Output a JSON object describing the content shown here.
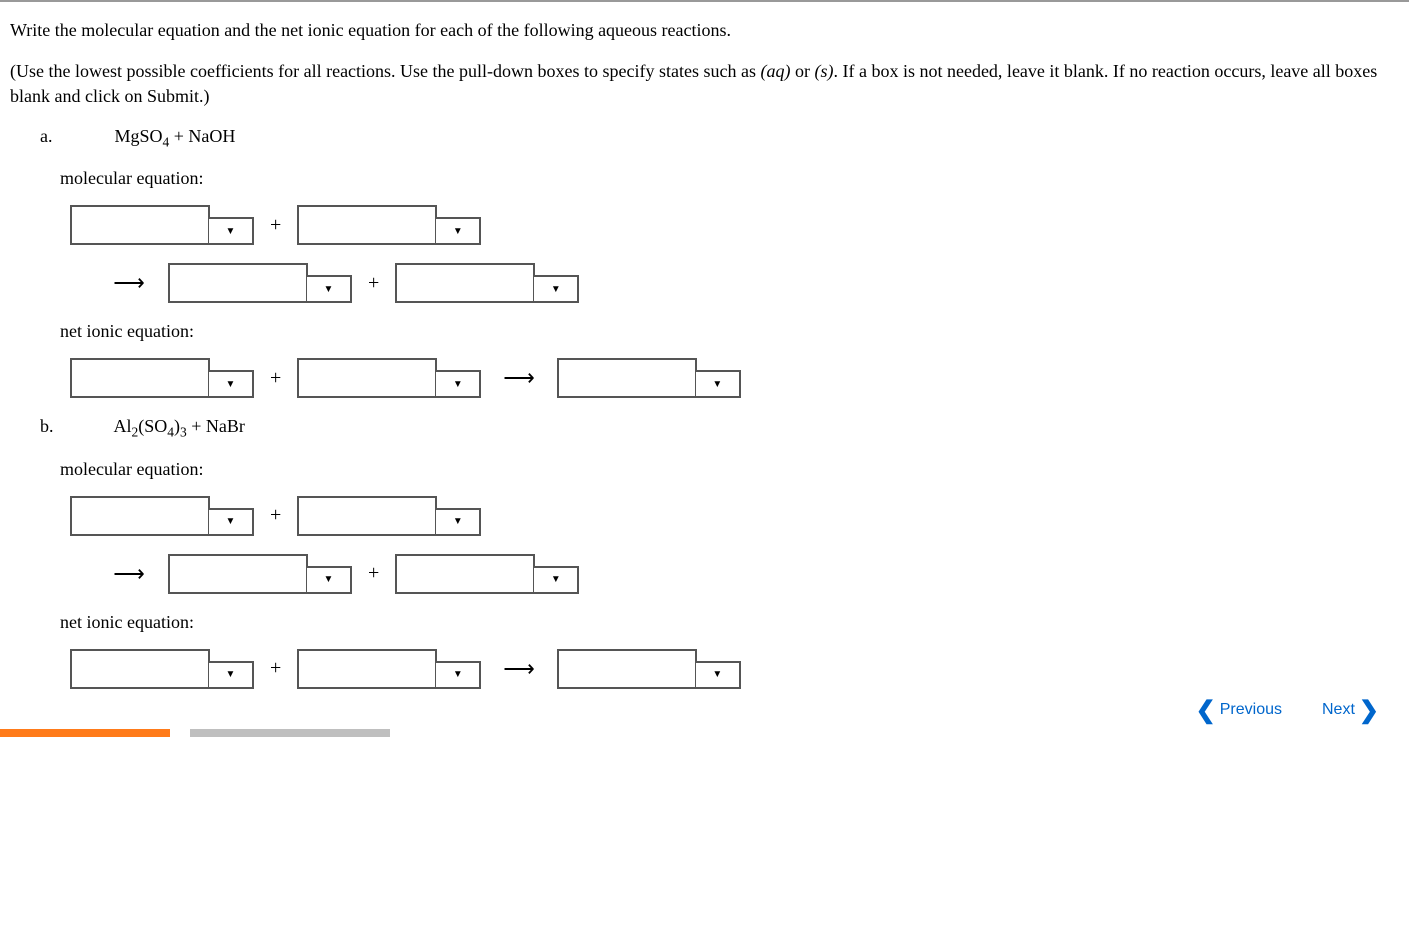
{
  "intro_line1": "Write the molecular equation and the net ionic equation for each of the following aqueous reactions.",
  "intro_line2_pre": "(Use the lowest possible coefficients for all reactions. Use the pull-down boxes to specify states such as ",
  "state_aq": "(aq)",
  "intro_or": " or ",
  "state_s": "(s)",
  "intro_line2_post": ". If a box is not needed, leave it blank. If no reaction occurs, leave all boxes blank and click on Submit.)",
  "problems": {
    "a": {
      "letter": "a.",
      "formula_html": "MgSO₄ + NaOH"
    },
    "b": {
      "letter": "b.",
      "formula_html": "Al₂(SO₄)₃ + NaBr"
    }
  },
  "labels": {
    "molecular": "molecular equation:",
    "netionic": "net ionic equation:"
  },
  "ops": {
    "plus": "+",
    "arrow": "⟶"
  },
  "nav": {
    "previous": "Previous",
    "next": "Next"
  }
}
